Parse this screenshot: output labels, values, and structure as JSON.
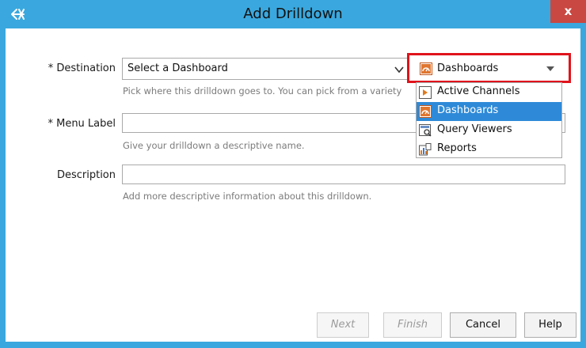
{
  "window": {
    "title": "Add Drilldown",
    "close_label": "x"
  },
  "form": {
    "destination": {
      "label": "* Destination",
      "value": "Select a Dashboard",
      "hint": "Pick where this drilldown goes to. You can pick from a variety"
    },
    "menu_label": {
      "label": "* Menu Label",
      "value": "",
      "hint": "Give your drilldown a descriptive name."
    },
    "description": {
      "label": "Description",
      "value": "",
      "hint": "Add more descriptive information about this drilldown."
    }
  },
  "type_select": {
    "selected": "Dashboards",
    "options": [
      {
        "label": "Active Channels",
        "icon": "active-channel-icon",
        "selected": false
      },
      {
        "label": "Dashboards",
        "icon": "dashboard-icon",
        "selected": true
      },
      {
        "label": "Query Viewers",
        "icon": "query-viewer-icon",
        "selected": false
      },
      {
        "label": "Reports",
        "icon": "report-icon",
        "selected": false
      }
    ]
  },
  "buttons": {
    "next": "Next",
    "finish": "Finish",
    "cancel": "Cancel",
    "help": "Help"
  },
  "colors": {
    "frame": "#3aa8de",
    "highlight": "#e0131b",
    "selection": "#2e8ad8",
    "close": "#c94841"
  }
}
